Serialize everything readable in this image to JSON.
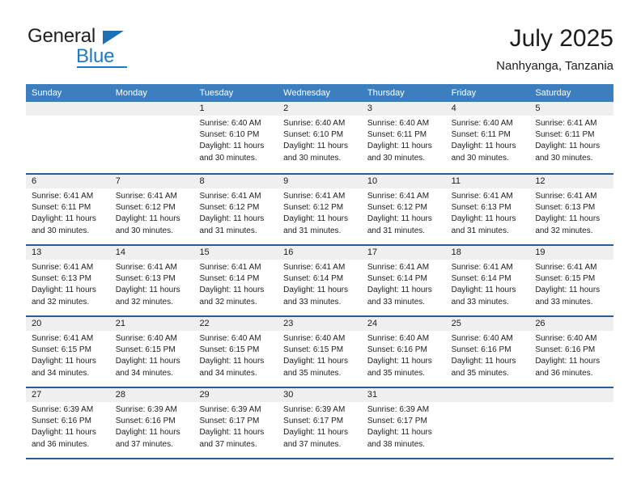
{
  "brand": {
    "word_one": "General",
    "word_two": "Blue",
    "triangle_icon": "triangle-icon",
    "accent_color": "#1f7ac4"
  },
  "header": {
    "title": "July 2025",
    "subtitle": "Nanhyanga, Tanzania"
  },
  "calendar": {
    "header_background": "#3c7fbf",
    "row_divider_color": "#1f5fa0",
    "date_band_color": "#efefef",
    "weekdays": [
      "Sunday",
      "Monday",
      "Tuesday",
      "Wednesday",
      "Thursday",
      "Friday",
      "Saturday"
    ],
    "weeks": [
      [
        {
          "day": "",
          "sunrise": "",
          "sunset": "",
          "daylight_line1": "",
          "daylight_line2": ""
        },
        {
          "day": "",
          "sunrise": "",
          "sunset": "",
          "daylight_line1": "",
          "daylight_line2": ""
        },
        {
          "day": "1",
          "sunrise": "Sunrise: 6:40 AM",
          "sunset": "Sunset: 6:10 PM",
          "daylight_line1": "Daylight: 11 hours",
          "daylight_line2": "and 30 minutes."
        },
        {
          "day": "2",
          "sunrise": "Sunrise: 6:40 AM",
          "sunset": "Sunset: 6:10 PM",
          "daylight_line1": "Daylight: 11 hours",
          "daylight_line2": "and 30 minutes."
        },
        {
          "day": "3",
          "sunrise": "Sunrise: 6:40 AM",
          "sunset": "Sunset: 6:11 PM",
          "daylight_line1": "Daylight: 11 hours",
          "daylight_line2": "and 30 minutes."
        },
        {
          "day": "4",
          "sunrise": "Sunrise: 6:40 AM",
          "sunset": "Sunset: 6:11 PM",
          "daylight_line1": "Daylight: 11 hours",
          "daylight_line2": "and 30 minutes."
        },
        {
          "day": "5",
          "sunrise": "Sunrise: 6:41 AM",
          "sunset": "Sunset: 6:11 PM",
          "daylight_line1": "Daylight: 11 hours",
          "daylight_line2": "and 30 minutes."
        }
      ],
      [
        {
          "day": "6",
          "sunrise": "Sunrise: 6:41 AM",
          "sunset": "Sunset: 6:11 PM",
          "daylight_line1": "Daylight: 11 hours",
          "daylight_line2": "and 30 minutes."
        },
        {
          "day": "7",
          "sunrise": "Sunrise: 6:41 AM",
          "sunset": "Sunset: 6:12 PM",
          "daylight_line1": "Daylight: 11 hours",
          "daylight_line2": "and 30 minutes."
        },
        {
          "day": "8",
          "sunrise": "Sunrise: 6:41 AM",
          "sunset": "Sunset: 6:12 PM",
          "daylight_line1": "Daylight: 11 hours",
          "daylight_line2": "and 31 minutes."
        },
        {
          "day": "9",
          "sunrise": "Sunrise: 6:41 AM",
          "sunset": "Sunset: 6:12 PM",
          "daylight_line1": "Daylight: 11 hours",
          "daylight_line2": "and 31 minutes."
        },
        {
          "day": "10",
          "sunrise": "Sunrise: 6:41 AM",
          "sunset": "Sunset: 6:12 PM",
          "daylight_line1": "Daylight: 11 hours",
          "daylight_line2": "and 31 minutes."
        },
        {
          "day": "11",
          "sunrise": "Sunrise: 6:41 AM",
          "sunset": "Sunset: 6:13 PM",
          "daylight_line1": "Daylight: 11 hours",
          "daylight_line2": "and 31 minutes."
        },
        {
          "day": "12",
          "sunrise": "Sunrise: 6:41 AM",
          "sunset": "Sunset: 6:13 PM",
          "daylight_line1": "Daylight: 11 hours",
          "daylight_line2": "and 32 minutes."
        }
      ],
      [
        {
          "day": "13",
          "sunrise": "Sunrise: 6:41 AM",
          "sunset": "Sunset: 6:13 PM",
          "daylight_line1": "Daylight: 11 hours",
          "daylight_line2": "and 32 minutes."
        },
        {
          "day": "14",
          "sunrise": "Sunrise: 6:41 AM",
          "sunset": "Sunset: 6:13 PM",
          "daylight_line1": "Daylight: 11 hours",
          "daylight_line2": "and 32 minutes."
        },
        {
          "day": "15",
          "sunrise": "Sunrise: 6:41 AM",
          "sunset": "Sunset: 6:14 PM",
          "daylight_line1": "Daylight: 11 hours",
          "daylight_line2": "and 32 minutes."
        },
        {
          "day": "16",
          "sunrise": "Sunrise: 6:41 AM",
          "sunset": "Sunset: 6:14 PM",
          "daylight_line1": "Daylight: 11 hours",
          "daylight_line2": "and 33 minutes."
        },
        {
          "day": "17",
          "sunrise": "Sunrise: 6:41 AM",
          "sunset": "Sunset: 6:14 PM",
          "daylight_line1": "Daylight: 11 hours",
          "daylight_line2": "and 33 minutes."
        },
        {
          "day": "18",
          "sunrise": "Sunrise: 6:41 AM",
          "sunset": "Sunset: 6:14 PM",
          "daylight_line1": "Daylight: 11 hours",
          "daylight_line2": "and 33 minutes."
        },
        {
          "day": "19",
          "sunrise": "Sunrise: 6:41 AM",
          "sunset": "Sunset: 6:15 PM",
          "daylight_line1": "Daylight: 11 hours",
          "daylight_line2": "and 33 minutes."
        }
      ],
      [
        {
          "day": "20",
          "sunrise": "Sunrise: 6:41 AM",
          "sunset": "Sunset: 6:15 PM",
          "daylight_line1": "Daylight: 11 hours",
          "daylight_line2": "and 34 minutes."
        },
        {
          "day": "21",
          "sunrise": "Sunrise: 6:40 AM",
          "sunset": "Sunset: 6:15 PM",
          "daylight_line1": "Daylight: 11 hours",
          "daylight_line2": "and 34 minutes."
        },
        {
          "day": "22",
          "sunrise": "Sunrise: 6:40 AM",
          "sunset": "Sunset: 6:15 PM",
          "daylight_line1": "Daylight: 11 hours",
          "daylight_line2": "and 34 minutes."
        },
        {
          "day": "23",
          "sunrise": "Sunrise: 6:40 AM",
          "sunset": "Sunset: 6:15 PM",
          "daylight_line1": "Daylight: 11 hours",
          "daylight_line2": "and 35 minutes."
        },
        {
          "day": "24",
          "sunrise": "Sunrise: 6:40 AM",
          "sunset": "Sunset: 6:16 PM",
          "daylight_line1": "Daylight: 11 hours",
          "daylight_line2": "and 35 minutes."
        },
        {
          "day": "25",
          "sunrise": "Sunrise: 6:40 AM",
          "sunset": "Sunset: 6:16 PM",
          "daylight_line1": "Daylight: 11 hours",
          "daylight_line2": "and 35 minutes."
        },
        {
          "day": "26",
          "sunrise": "Sunrise: 6:40 AM",
          "sunset": "Sunset: 6:16 PM",
          "daylight_line1": "Daylight: 11 hours",
          "daylight_line2": "and 36 minutes."
        }
      ],
      [
        {
          "day": "27",
          "sunrise": "Sunrise: 6:39 AM",
          "sunset": "Sunset: 6:16 PM",
          "daylight_line1": "Daylight: 11 hours",
          "daylight_line2": "and 36 minutes."
        },
        {
          "day": "28",
          "sunrise": "Sunrise: 6:39 AM",
          "sunset": "Sunset: 6:16 PM",
          "daylight_line1": "Daylight: 11 hours",
          "daylight_line2": "and 37 minutes."
        },
        {
          "day": "29",
          "sunrise": "Sunrise: 6:39 AM",
          "sunset": "Sunset: 6:17 PM",
          "daylight_line1": "Daylight: 11 hours",
          "daylight_line2": "and 37 minutes."
        },
        {
          "day": "30",
          "sunrise": "Sunrise: 6:39 AM",
          "sunset": "Sunset: 6:17 PM",
          "daylight_line1": "Daylight: 11 hours",
          "daylight_line2": "and 37 minutes."
        },
        {
          "day": "31",
          "sunrise": "Sunrise: 6:39 AM",
          "sunset": "Sunset: 6:17 PM",
          "daylight_line1": "Daylight: 11 hours",
          "daylight_line2": "and 38 minutes."
        },
        {
          "day": "",
          "sunrise": "",
          "sunset": "",
          "daylight_line1": "",
          "daylight_line2": ""
        },
        {
          "day": "",
          "sunrise": "",
          "sunset": "",
          "daylight_line1": "",
          "daylight_line2": ""
        }
      ]
    ]
  }
}
